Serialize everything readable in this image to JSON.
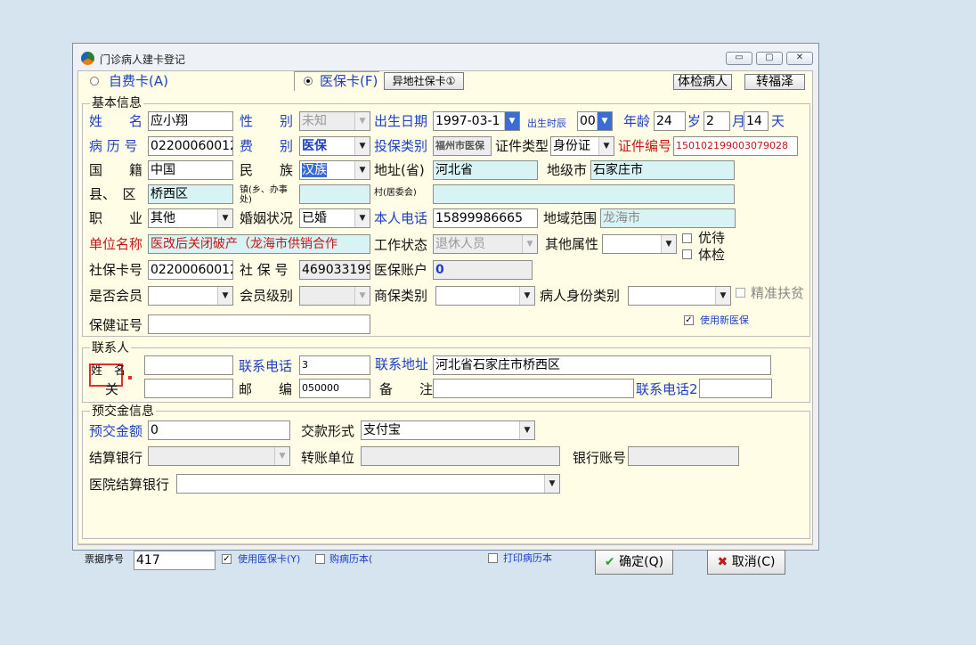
{
  "window": {
    "title": "门诊病人建卡登记"
  },
  "tabs": [
    {
      "label": "自费卡(A)"
    },
    {
      "label": "医保卡(F)"
    }
  ],
  "toolbar": {
    "remote_card": "异地社保卡①",
    "checkup_patient": "体检病人",
    "transfer": "转福泽"
  },
  "basic_group": "基本信息",
  "fields": {
    "name_label": "姓　　名",
    "name": "应小翔",
    "gender_label": "性　　别",
    "gender": "未知",
    "birth_label": "出生日期",
    "birth": "1997-03-1",
    "birth_hour_label": "出生时辰",
    "birth_hour": "00",
    "age_label": "年龄",
    "age_years": "24",
    "age_years_unit": "岁",
    "age_months": "2",
    "age_months_unit": "月",
    "age_days": "14",
    "age_days_unit": "天",
    "record_label": "病 历 号",
    "record": "02200060012",
    "fee_label": "费　　别",
    "fee": "医保",
    "insure_type_label": "投保类别",
    "insure_type": "福州市医保",
    "id_type_label": "证件类型",
    "id_type": "身份证",
    "id_no_label": "证件编号",
    "id_no": "150102199003079028",
    "nation_label": "国　　籍",
    "nation": "中国",
    "ethnic_label": "民　　族",
    "ethnic": "汉族",
    "province_label": "地址(省)",
    "province": "河北省",
    "city_label": "地级市",
    "city": "石家庄市",
    "county_label": "县、　区",
    "county": "桥西区",
    "town_label": "镇(乡、办事处)",
    "town": "",
    "village_label": "村(居委会)",
    "village": "",
    "job_label": "职　　业",
    "job": "其他",
    "marital_label": "婚姻状况",
    "marital": "已婚",
    "phone_label": "本人电话",
    "phone": "15899986665",
    "region_label": "地域范围",
    "region": "龙海市",
    "employer_label": "单位名称",
    "employer": "医改后关闭破产（龙海市供销合作",
    "work_status_label": "工作状态",
    "work_status": "退休人员",
    "other_attr_label": "其他属性",
    "other_attr": "",
    "vip_label": "优待",
    "checkup_label": "体检",
    "ss_card_label": "社保卡号",
    "ss_card": "02200060012",
    "ss_no_label": "社 保 号",
    "ss_no": "469033199",
    "med_account_label": "医保账户",
    "med_account": "0",
    "member_label": "是否会员",
    "member": "",
    "member_level_label": "会员级别",
    "member_level": "",
    "commercial_label": "商保类别",
    "commercial": "",
    "patient_type_label": "病人身份类别",
    "patient_type": "",
    "poverty_label": "精准扶贫",
    "health_no_label": "保健证号",
    "health_no": "",
    "use_new_insurance_label": "使用新医保"
  },
  "contact_group": "联系人",
  "contact": {
    "name_label": "姓　名",
    "name": "",
    "phone_label": "联系电话",
    "phone": "3",
    "address_label": "联系地址",
    "address": "河北省石家庄市桥西区",
    "relation_label": "关　　系",
    "relation": "",
    "zip_label": "邮　　编",
    "zip": "050000",
    "remark_label": "备　　注",
    "remark": "",
    "phone2_label": "联系电话2",
    "phone2": ""
  },
  "deposit_group": "预交金信息",
  "deposit": {
    "amount_label": "预交金额",
    "amount": "0",
    "pay_label": "交款形式",
    "pay": "支付宝",
    "bank_label": "结算银行",
    "bank": "",
    "transfer_label": "转账单位",
    "transfer": "",
    "account_label": "银行账号",
    "account": "",
    "hospital_bank_label": "医院结算银行",
    "hospital_bank": ""
  },
  "footer": {
    "receipt_label": "票据序号",
    "receipt": "417",
    "use_card_label": "使用医保卡(Y)",
    "buy_record_label": "购病历本(",
    "print_record_label": "打印病历本",
    "ok_label": "确定(Q)",
    "cancel_label": "取消(C)"
  },
  "colors": {
    "accent_blue": "#1f3fc4",
    "alert_red": "#c41818",
    "panel": "#fffde6",
    "cyan_field": "#d7f3f3"
  }
}
